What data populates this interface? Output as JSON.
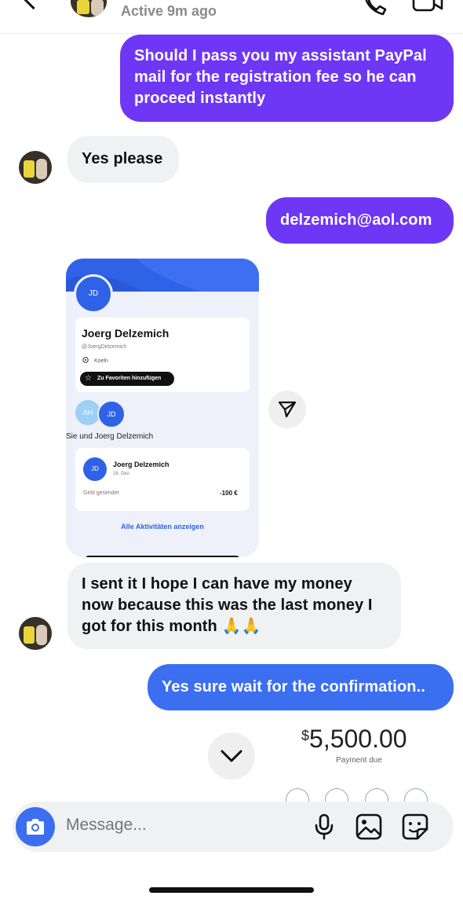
{
  "header": {
    "status": "Active 9m ago"
  },
  "messages": {
    "m1": "Should I pass you my assistant PayPal mail for the registration fee so he can proceed instantly",
    "m2": "Yes please",
    "m3": "delzemich@aol.com",
    "m5": "I sent it I hope I can have my money now because this was the last money I got for this month 🙏🙏",
    "m6": "Yes sure wait for the confirmation.."
  },
  "paypal_card": {
    "initials": "JD",
    "name": "Joerg Delzemich",
    "handle": "@JoergDelzemich",
    "location": "Koeln",
    "favorite_btn": "Zu Favoriten hinzufügen",
    "circle_a": "AH",
    "circle_b": "JD",
    "with_label": "Sie und Joerg Delzemich",
    "tx_initials": "JD",
    "tx_name": "Joerg Delzemich",
    "tx_date": "16. Dez.",
    "tx_desc": "Geld gesendet",
    "tx_amount": "-100 €",
    "show_all": "Alle Aktivitäten anzeigen"
  },
  "peek_invoice": {
    "currency": "$",
    "amount": "5,500.00",
    "label": "Payment due"
  },
  "composer": {
    "placeholder": "Message..."
  },
  "colors": {
    "outgoing_purple": "#6e37f5",
    "outgoing_blue": "#3c6ef0",
    "incoming_gray": "#f0f1f3",
    "paypal_blue": "#2f62e6"
  },
  "icons": [
    "back-chevron-icon",
    "phone-icon",
    "video-camera-icon",
    "share-icon",
    "chevron-down-icon",
    "camera-icon",
    "microphone-icon",
    "image-icon",
    "sticker-icon"
  ]
}
